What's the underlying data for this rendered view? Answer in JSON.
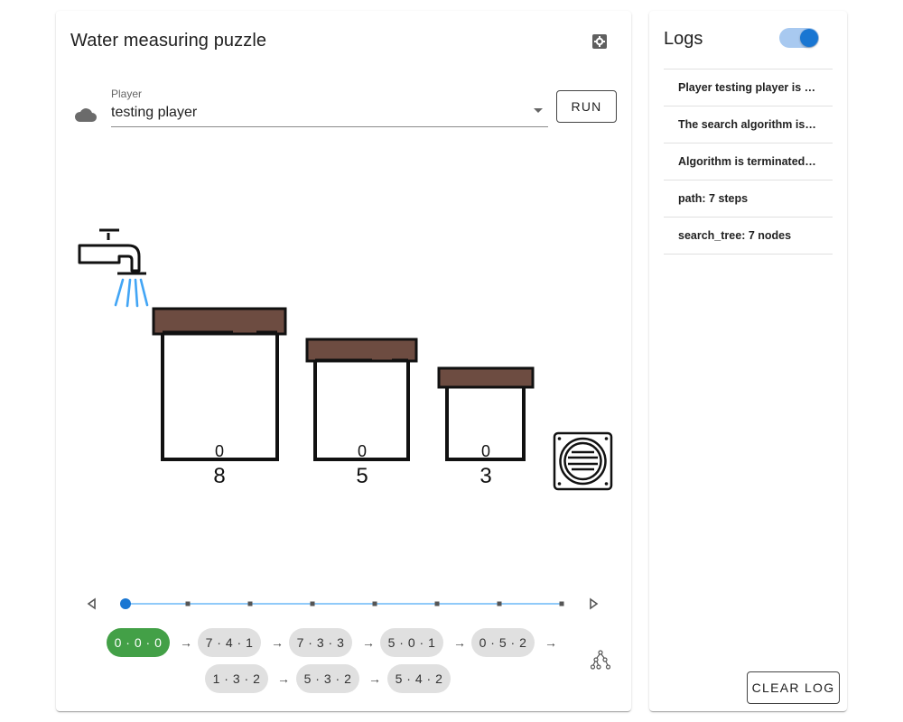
{
  "main": {
    "title": "Water measuring puzzle",
    "settings_icon": "gear-icon",
    "player": {
      "label": "Player",
      "value": "testing player",
      "icon": "cloud-icon"
    },
    "run_label": "RUN",
    "jugs": [
      {
        "current": "0",
        "capacity": "8"
      },
      {
        "current": "0",
        "capacity": "5"
      },
      {
        "current": "0",
        "capacity": "3"
      }
    ],
    "timeline": {
      "steps": 8,
      "position": 0
    },
    "path": [
      {
        "state": "0 · 0 · 0",
        "active": true
      },
      {
        "state": "7 · 4 · 1"
      },
      {
        "state": "7 · 3 · 3"
      },
      {
        "state": "5 · 0 · 1"
      },
      {
        "state": "0 · 5 · 2"
      },
      {
        "state": "1 · 3 · 2"
      },
      {
        "state": "5 · 3 · 2"
      },
      {
        "state": "5 · 4 · 2"
      }
    ],
    "arrow": "→",
    "tree_icon": "tree-icon"
  },
  "logs": {
    "title": "Logs",
    "toggle_on": true,
    "items": [
      "Player testing player is initialized",
      "The search algorithm is initialized",
      "Algorithm is terminated, solution found",
      "path: 7 steps",
      "search_tree: 7 nodes"
    ],
    "clear_label": "CLEAR LOG"
  },
  "colors": {
    "accent": "#1976d2",
    "chip_active": "#43a047",
    "lid": "#6d4c41",
    "water": "#42a5f5"
  }
}
